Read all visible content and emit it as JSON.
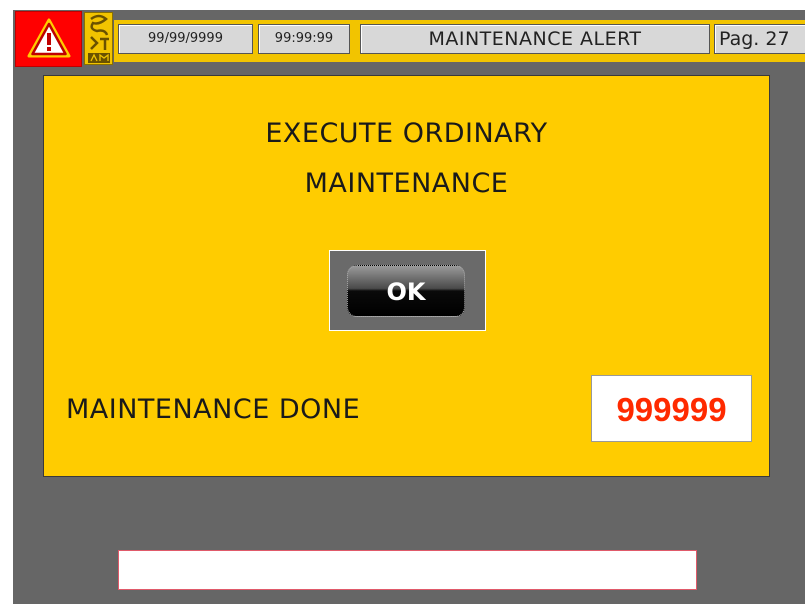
{
  "header": {
    "alarm_icon": "warning-triangle-icon",
    "logo_icon": "company-logo-icon",
    "date": "99/99/9999",
    "time": "99:99:99",
    "title": "MAINTENANCE ALERT",
    "page": "Pag. 27"
  },
  "panel": {
    "message_line1": "EXECUTE ORDINARY",
    "message_line2": "MAINTENANCE",
    "ok_label": "OK",
    "done_label": "MAINTENANCE DONE",
    "done_count": "999999"
  },
  "status_bar": {
    "text": ""
  },
  "colors": {
    "background": "#666666",
    "panel": "#ffcc00",
    "alarm": "#ff0000",
    "counter_text": "#ff2a00"
  }
}
